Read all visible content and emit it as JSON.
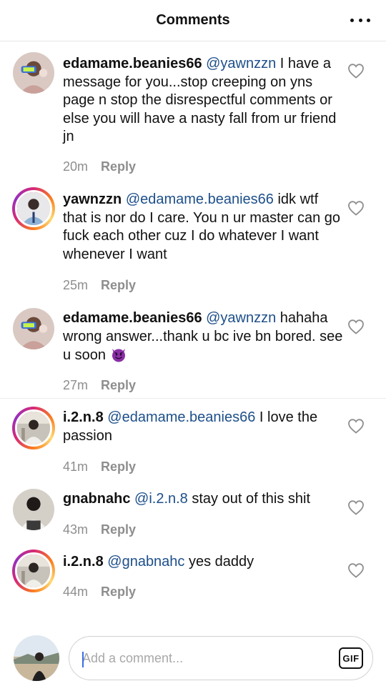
{
  "header": {
    "title": "Comments",
    "more_icon": "more-horizontal-icon"
  },
  "comments": [
    {
      "username": "edamame.beanies66",
      "mention": "@yawnzzn",
      "text": " I have a message for you...stop creeping on yns page n stop the disrespectful comments or else you will have a nasty fall from ur friend jn",
      "time": "20m",
      "reply": "Reply",
      "has_story_ring": false
    },
    {
      "username": "yawnzzn",
      "mention": "@edamame.beanies66",
      "text": " idk wtf that is nor do I care. You n ur master can go fuck each other cuz I do whatever I want whenever I want",
      "time": "25m",
      "reply": "Reply",
      "has_story_ring": true
    },
    {
      "username": "edamame.beanies66",
      "mention": "@yawnzzn",
      "text": " hahaha wrong answer...thank u bc ive bn bored. see u soon ",
      "emoji": "smiling-devil-emoji",
      "time": "27m",
      "reply": "Reply",
      "has_story_ring": false
    },
    {
      "username": "i.2.n.8",
      "mention": "@edamame.beanies66",
      "text": " I love the passion",
      "time": "41m",
      "reply": "Reply",
      "has_story_ring": true
    },
    {
      "username": "gnabnahc",
      "mention": "@i.2.n.8",
      "text": " stay out of this shit",
      "time": "43m",
      "reply": "Reply",
      "has_story_ring": false
    },
    {
      "username": "i.2.n.8",
      "mention": "@gnabnahc",
      "text": " yes daddy",
      "time": "44m",
      "reply": "Reply",
      "has_story_ring": true
    }
  ],
  "composer": {
    "placeholder": "Add a comment...",
    "gif_label": "GIF"
  },
  "colors": {
    "mention": "#1d4f8a",
    "meta": "#8e8e8e",
    "ring_start": "#d62976",
    "ring_end": "#feda75"
  }
}
